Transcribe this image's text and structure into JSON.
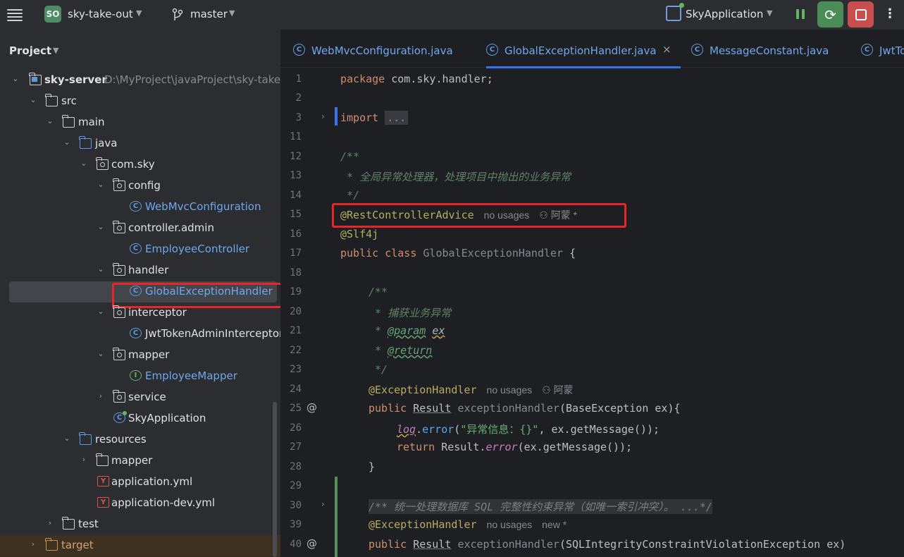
{
  "titlebar": {
    "project_badge": "SO",
    "project_name": "sky-take-out",
    "branch": "master",
    "run_config": "SkyApplication",
    "icons": [
      "hamburger-menu-icon",
      "git-branch-icon",
      "pause-icon",
      "rerun-icon",
      "stop-icon",
      "more-vertical-icon"
    ]
  },
  "project_panel": {
    "title": "Project",
    "tree": [
      {
        "label": "sky-server",
        "hint": "D:\\MyProject\\javaProject\\sky-take-out",
        "kind": "module"
      },
      {
        "label": "src",
        "kind": "folder"
      },
      {
        "label": "main",
        "kind": "folder"
      },
      {
        "label": "java",
        "kind": "source-folder"
      },
      {
        "label": "com.sky",
        "kind": "package"
      },
      {
        "label": "config",
        "kind": "package"
      },
      {
        "label": "WebMvcConfiguration",
        "kind": "class"
      },
      {
        "label": "controller.admin",
        "kind": "package"
      },
      {
        "label": "EmployeeController",
        "kind": "class"
      },
      {
        "label": "handler",
        "kind": "package"
      },
      {
        "label": "GlobalExceptionHandler",
        "kind": "class",
        "selected": true
      },
      {
        "label": "interceptor",
        "kind": "package"
      },
      {
        "label": "JwtTokenAdminInterceptor",
        "kind": "class"
      },
      {
        "label": "mapper",
        "kind": "package"
      },
      {
        "label": "EmployeeMapper",
        "kind": "interface"
      },
      {
        "label": "service",
        "kind": "package"
      },
      {
        "label": "SkyApplication",
        "kind": "boot-class"
      },
      {
        "label": "resources",
        "kind": "resource-folder"
      },
      {
        "label": "mapper",
        "kind": "folder"
      },
      {
        "label": "application.yml",
        "kind": "yaml"
      },
      {
        "label": "application-dev.yml",
        "kind": "yaml"
      },
      {
        "label": "test",
        "kind": "folder"
      },
      {
        "label": "target",
        "kind": "excluded-folder"
      }
    ]
  },
  "editor": {
    "tabs": [
      {
        "label": "WebMvcConfiguration.java",
        "active": false
      },
      {
        "label": "GlobalExceptionHandler.java",
        "active": true,
        "close": "×"
      },
      {
        "label": "MessageConstant.java",
        "active": false
      },
      {
        "label": "JwtTo",
        "active": false
      }
    ],
    "line_numbers": [
      "1",
      "2",
      "3",
      "11",
      "12",
      "13",
      "14",
      "15",
      "16",
      "17",
      "18",
      "19",
      "20",
      "21",
      "22",
      "23",
      "24",
      "25",
      "26",
      "27",
      "28",
      "29",
      "30",
      "39",
      "40"
    ],
    "code": {
      "l1_kw": "package",
      "l1_rest": " com.sky.handler;",
      "l3_kw": "import",
      "l3_fold": "...",
      "l12": "/**",
      "l13": " * 全局异常处理器，处理项目中抛出的业务异常",
      "l14": " */",
      "l15_ann": "@RestControllerAdvice",
      "l15_hint": "no usages",
      "l15_user": "阿蒙 *",
      "l16_ann": "@Slf4j",
      "l17_kw": "public class",
      "l17_cls": "GlobalExceptionHandler",
      "l17_rest": " {",
      "l19": "/**",
      "l20": " * 捕获业务异常",
      "l21_star": " * ",
      "l21_tag": "@param",
      "l21_param": "ex",
      "l22_star": " * ",
      "l22_tag": "@return",
      "l23": " */",
      "l24_ann": "@ExceptionHandler",
      "l24_hint": "no usages",
      "l24_user": "阿蒙",
      "l25_kw": "public",
      "l25_type": "Result",
      "l25_method": "exceptionHandler",
      "l25_rest": "(BaseException ex){",
      "l26_field": "log",
      "l26_method": "error",
      "l26_str": "\"异常信息：{}\"",
      "l26_rest": ", ex.getMessage());",
      "l27_kw": "return",
      "l27_cls": " Result.",
      "l27_method": "error",
      "l27_rest": "(ex.getMessage());",
      "l28": "}",
      "l30": "/** 统一处理数据库 SQL 完整性约束异常（如唯一索引冲突）。 ...*/",
      "l39_ann": "@ExceptionHandler",
      "l39_hint": "no usages",
      "l39_user": "new *",
      "l40_kw": "public",
      "l40_type": "Result",
      "l40_method": "exceptionHandler",
      "l40_rest": "(SQLIntegrityConstraintViolationException ex)"
    }
  },
  "colors": {
    "annotation_highlight": "#e8262a",
    "keyword": "#cf8e6d",
    "annotation": "#b3ae60",
    "string": "#6aab73",
    "accent": "#3574f0"
  }
}
